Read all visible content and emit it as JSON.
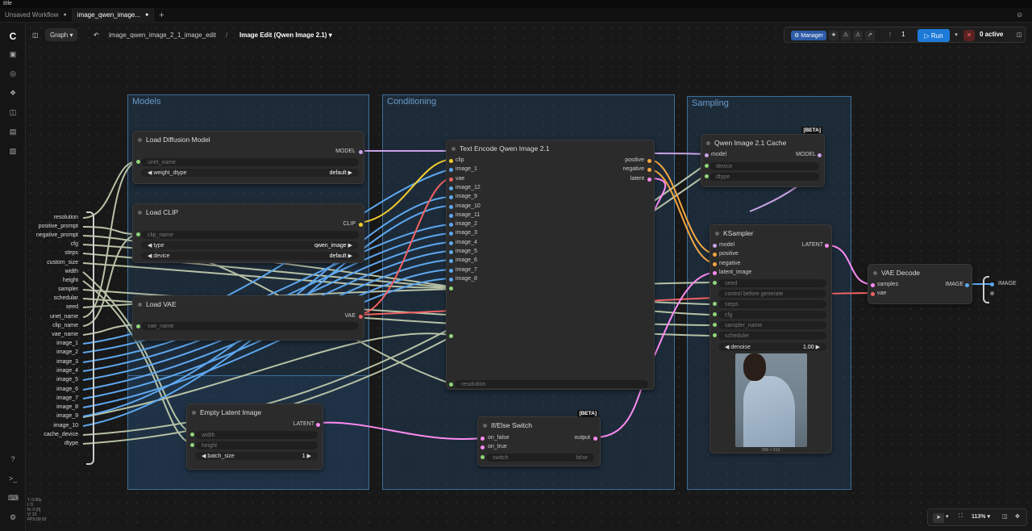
{
  "window": {
    "title": "title"
  },
  "tabs": [
    {
      "label": "Unsaved Workflow"
    },
    {
      "label": "image_qwen_image..."
    }
  ],
  "topbar": {
    "graph_label": "Graph",
    "breadcrumb_file": "image_qwen_image_2_1_image_edit",
    "breadcrumb_sep": "/",
    "breadcrumb_title": "Image Edit (Qwen Image 2.1)",
    "manager_label": "Manager",
    "queue_count": "1",
    "run_label": "Run",
    "active_label": "0 active"
  },
  "groups": {
    "models": "Models",
    "conditioning": "Conditioning",
    "sampling": "Sampling"
  },
  "inputs_list": [
    "resolution",
    "positive_prompt",
    "negative_prompt",
    "cfg",
    "steps",
    "custom_size",
    "width",
    "height",
    "sampler",
    "schedular",
    "seed",
    "unet_name",
    "clip_name",
    "vae_name",
    "image_1",
    "image_2",
    "image_3",
    "image_4",
    "image_5",
    "image_6",
    "image_7",
    "image_8",
    "image_9",
    "image_10",
    "cache_device",
    "dtype"
  ],
  "nodes": {
    "load_diffusion": {
      "title": "Load Diffusion Model",
      "out": "MODEL",
      "w1": "unet_name",
      "w2": "weight_dtype",
      "w2_val": "default"
    },
    "load_clip": {
      "title": "Load CLIP",
      "out": "CLIP",
      "w1": "clip_name",
      "w2": "type",
      "w2_val": "qwen_image",
      "w3": "device",
      "w3_val": "default"
    },
    "load_vae": {
      "title": "Load VAE",
      "out": "VAE",
      "w1": "vae_name"
    },
    "empty_latent": {
      "title": "Empty Latent Image",
      "out": "LATENT",
      "w1": "width",
      "w2": "height",
      "w3": "batch_size",
      "w3_val": "1"
    },
    "text_encode": {
      "title": "Text Encode Qwen Image 2.1",
      "inputs": [
        "clip",
        "image_1",
        "vae",
        "image_12",
        "image_9",
        "image_10",
        "image_11",
        "image_2",
        "image_3",
        "image_4",
        "image_5",
        "image_6",
        "image_7",
        "image_8"
      ],
      "outputs": [
        "positive",
        "negative",
        "latent"
      ],
      "w_res": "resolution"
    },
    "ifelse": {
      "title": "If/Else Switch",
      "beta": "[BETA]",
      "in1": "on_false",
      "in2": "on_true",
      "out": "output",
      "w": "switch",
      "w_val": "false"
    },
    "cache": {
      "title": "Qwen Image 2.1 Cache",
      "beta": "[BETA]",
      "in": "model",
      "out": "MODEL",
      "w1": "device",
      "w2": "dtype"
    },
    "ksampler": {
      "title": "KSampler",
      "inputs": [
        "model",
        "positive",
        "negative",
        "latent_image"
      ],
      "out": "LATENT",
      "widgets": [
        "seed",
        "control before generate",
        "steps",
        "cfg",
        "sampler_name",
        "scheduler"
      ],
      "denoise": "denoise",
      "denoise_val": "1.00",
      "caption": "600 × 512"
    },
    "vae_decode": {
      "title": "VAE Decode",
      "in1": "samples",
      "in2": "vae",
      "out": "IMAGE"
    }
  },
  "output_label": "IMAGE",
  "status_lines": [
    "T: 0.00s",
    "I: 0",
    "N: 0 [0]",
    "V: 22",
    "FPS:59.52"
  ],
  "zoom": "113%"
}
